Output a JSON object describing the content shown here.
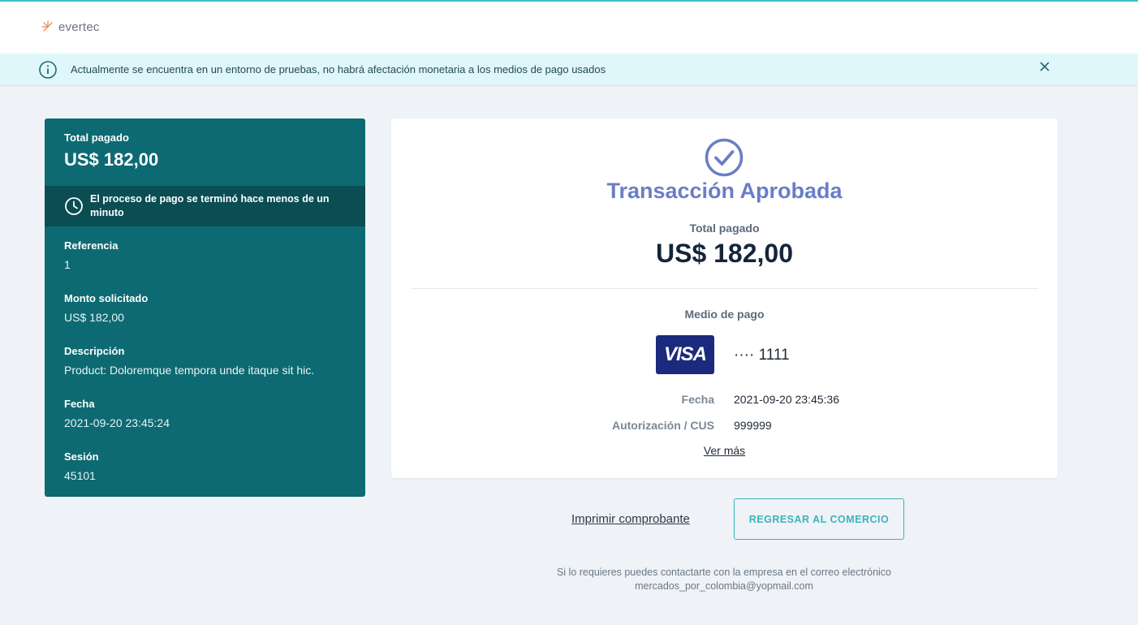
{
  "header": {
    "brand": "evertec"
  },
  "banner": {
    "icon": "info-icon",
    "message": "Actualmente se encuentra en un entorno de pruebas, no habrá afectación monetaria a los medios de pago usados",
    "close_icon": "close-icon"
  },
  "summary": {
    "total_label": "Total pagado",
    "total_value": "US$ 182,00",
    "status_icon": "clock-icon",
    "status_text": "El proceso de pago se terminó hace menos de un minuto",
    "fields": [
      {
        "label": "Referencia",
        "value": "1"
      },
      {
        "label": "Monto solicitado",
        "value": "US$ 182,00"
      },
      {
        "label": "Descripción",
        "value": "Product: Doloremque tempora unde itaque sit hic."
      },
      {
        "label": "Fecha",
        "value": "2021-09-20 23:45:24"
      },
      {
        "label": "Sesión",
        "value": "45101"
      }
    ]
  },
  "result": {
    "icon": "check-circle-icon",
    "title": "Transacción Aprobada",
    "total_label": "Total pagado",
    "total_value": "US$ 182,00",
    "payment_method_label": "Medio de pago",
    "card_brand": "VISA",
    "card_number": "···· 1111",
    "date_label": "Fecha",
    "date_value": "2021-09-20 23:45:36",
    "auth_label": "Autorización / CUS",
    "auth_value": "999999",
    "more_link": "Ver más"
  },
  "actions": {
    "print_label": "Imprimir comprobante",
    "return_label": "REGRESAR AL COMERCIO"
  },
  "footer": {
    "line1": "Si lo requieres puedes contactarte con la empresa en el correo electrónico",
    "line2": "mercados_por_colombia@yopmail.com"
  },
  "colors": {
    "teal_panel": "#0d6a72",
    "teal_dark": "#0a4d53",
    "approved": "#6a7ec6",
    "accent": "#3ab4bd",
    "visa": "#1b2a7c"
  }
}
